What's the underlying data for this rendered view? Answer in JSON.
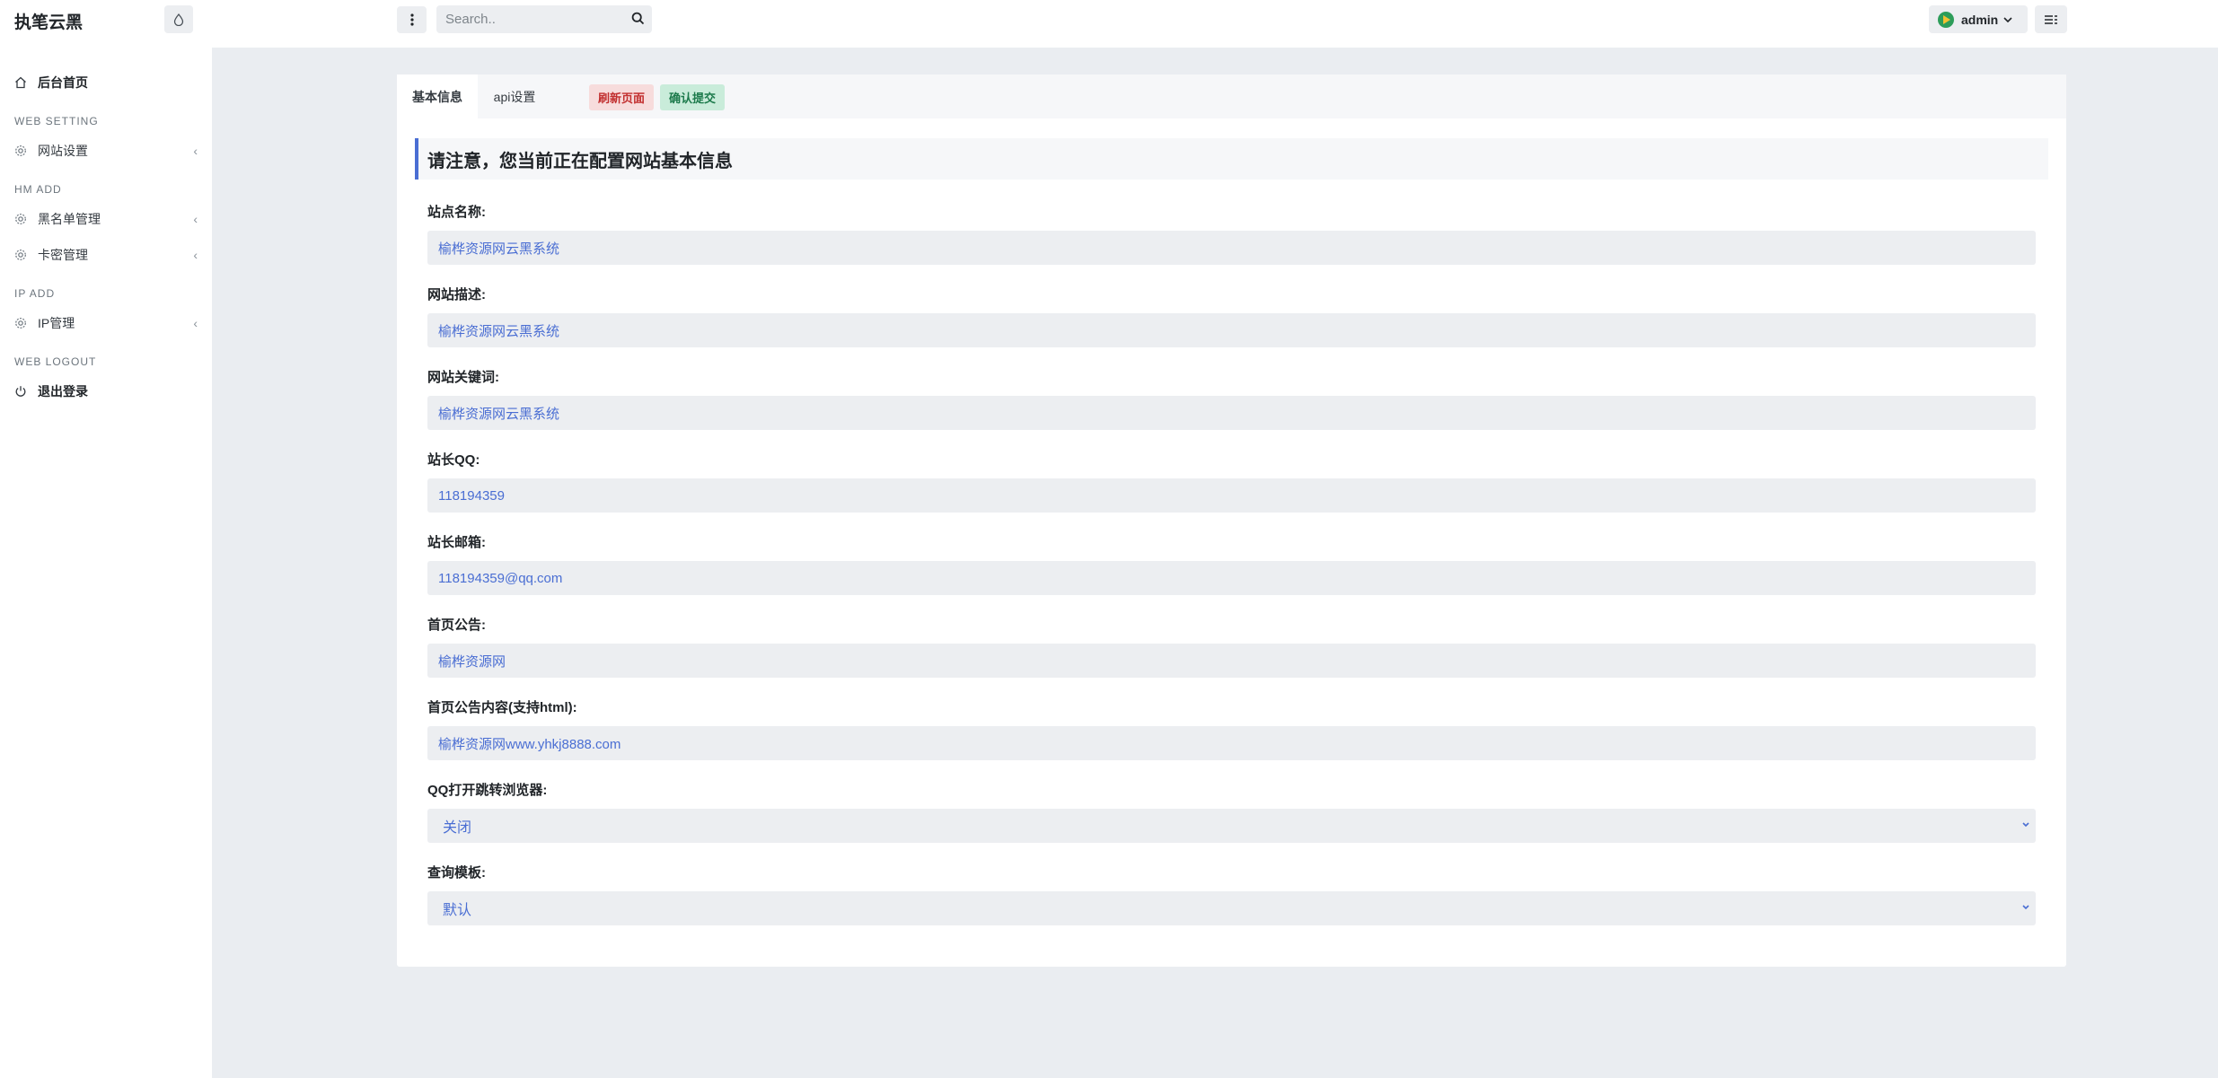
{
  "brand": "执笔云黑",
  "sidebar": {
    "home": "后台首页",
    "sections": [
      {
        "heading": "WEB SETTING",
        "items": [
          "网站设置"
        ]
      },
      {
        "heading": "HM ADD",
        "items": [
          "黑名单管理",
          "卡密管理"
        ]
      },
      {
        "heading": "IP ADD",
        "items": [
          "IP管理"
        ]
      },
      {
        "heading": "WEB LOGOUT",
        "items": [
          "退出登录"
        ]
      }
    ]
  },
  "topbar": {
    "search_placeholder": "Search..",
    "user": "admin"
  },
  "tabs": [
    "基本信息",
    "api设置"
  ],
  "actions": {
    "refresh": "刷新页面",
    "confirm": "确认提交"
  },
  "notice": "请注意，您当前正在配置网站基本信息",
  "fields": [
    {
      "label": "站点名称:",
      "value": "榆桦资源网云黑系统",
      "type": "input"
    },
    {
      "label": "网站描述:",
      "value": "榆桦资源网云黑系统",
      "type": "input"
    },
    {
      "label": "网站关键词:",
      "value": "榆桦资源网云黑系统",
      "type": "input"
    },
    {
      "label": "站长QQ:",
      "value": "118194359",
      "type": "input"
    },
    {
      "label": "站长邮箱:",
      "value": "118194359@qq.com",
      "type": "input"
    },
    {
      "label": "首页公告:",
      "value": "榆桦资源网",
      "type": "input"
    },
    {
      "label": "首页公告内容(支持html):",
      "value": "榆桦资源网www.yhkj8888.com",
      "type": "input"
    },
    {
      "label": "QQ打开跳转浏览器:",
      "value": "关闭",
      "type": "select"
    },
    {
      "label": "查询模板:",
      "value": "默认",
      "type": "select"
    }
  ],
  "colors": {
    "accent": "#4a6ed3",
    "bg": "#eaedf1",
    "danger": "#c22f2f",
    "success": "#1c7a4b"
  }
}
